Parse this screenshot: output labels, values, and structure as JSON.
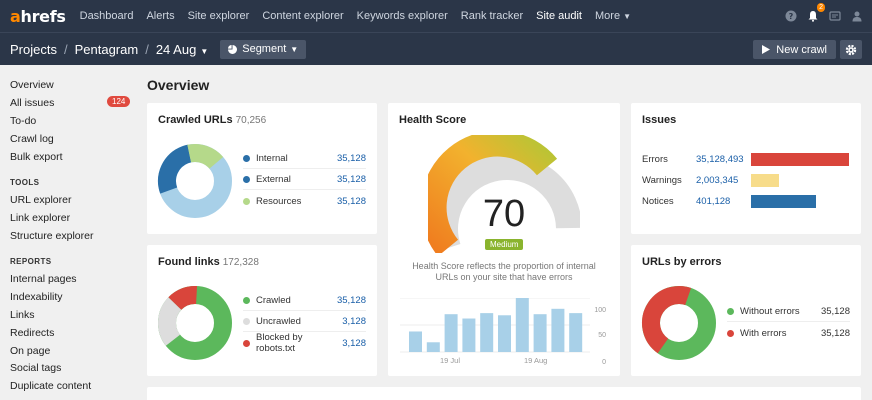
{
  "nav": {
    "logo_a": "a",
    "logo_rest": "hrefs",
    "items": [
      "Dashboard",
      "Alerts",
      "Site explorer",
      "Content explorer",
      "Keywords explorer",
      "Rank tracker",
      "Site audit",
      "More"
    ],
    "notification_count": "2"
  },
  "breadcrumb": {
    "projects": "Projects",
    "project": "Pentagram",
    "date": "24 Aug"
  },
  "segment_label": "Segment",
  "new_crawl_label": "New crawl",
  "sidebar": {
    "overview": "Overview",
    "all_issues": "All issues",
    "all_issues_count": "124",
    "todo": "To-do",
    "crawl_log": "Crawl log",
    "bulk_export": "Bulk export",
    "tools_head": "TOOLS",
    "url_explorer": "URL explorer",
    "link_explorer": "Link explorer",
    "structure_explorer": "Structure explorer",
    "reports_head": "REPORTS",
    "internal_pages": "Internal pages",
    "indexability": "Indexability",
    "links": "Links",
    "redirects": "Redirects",
    "on_page": "On page",
    "social_tags": "Social tags",
    "duplicate_content": "Duplicate content"
  },
  "main": {
    "title": "Overview",
    "crawled": {
      "title": "Crawled URLs",
      "count": "70,256",
      "rows": [
        {
          "label": "Internal",
          "value": "35,128",
          "color": "#2a6fa8"
        },
        {
          "label": "External",
          "value": "35,128",
          "color": "#2a6fa8"
        },
        {
          "label": "Resources",
          "value": "35,128",
          "color": "#b5d98a"
        }
      ]
    },
    "found": {
      "title": "Found links",
      "count": "172,328",
      "rows": [
        {
          "label": "Crawled",
          "value": "35,128",
          "color": "#5cb85c"
        },
        {
          "label": "Uncrawled",
          "value": "3,128",
          "color": "#dddddd"
        },
        {
          "label": "Blocked by robots.txt",
          "value": "3,128",
          "color": "#d9453b"
        }
      ]
    },
    "health": {
      "title": "Health Score",
      "score": "70",
      "level": "Medium",
      "description_1": "Health Score reflects the proportion of internal",
      "description_2": "URLs on your site that have errors",
      "y_ticks": [
        "100",
        "50",
        "0"
      ],
      "x_labels": [
        "19 Jul",
        "19 Aug"
      ]
    },
    "issues": {
      "title": "Issues",
      "rows": [
        {
          "label": "Errors",
          "value": "35,128,493",
          "color": "#d9453b",
          "fraction": 1.0
        },
        {
          "label": "Warnings",
          "value": "2,003,345",
          "color": "#f7dc8a",
          "fraction": 0.29
        },
        {
          "label": "Notices",
          "value": "401,128",
          "color": "#2a6fa8",
          "fraction": 0.66
        }
      ]
    },
    "urls_errors": {
      "title": "URLs by errors",
      "rows": [
        {
          "label": "Without errors",
          "value": "35,128",
          "color": "#5cb85c"
        },
        {
          "label": "With errors",
          "value": "35,128",
          "color": "#d9453b"
        }
      ]
    }
  },
  "chart_data": {
    "type": "bar",
    "categories": [
      "",
      "",
      "",
      "",
      "",
      "",
      "",
      "",
      "",
      ""
    ],
    "values": [
      38,
      18,
      70,
      62,
      72,
      68,
      100,
      70,
      80,
      72
    ],
    "xlabel": "",
    "ylabel": "",
    "ylim": [
      0,
      100
    ],
    "color": "#a8d0e8"
  }
}
